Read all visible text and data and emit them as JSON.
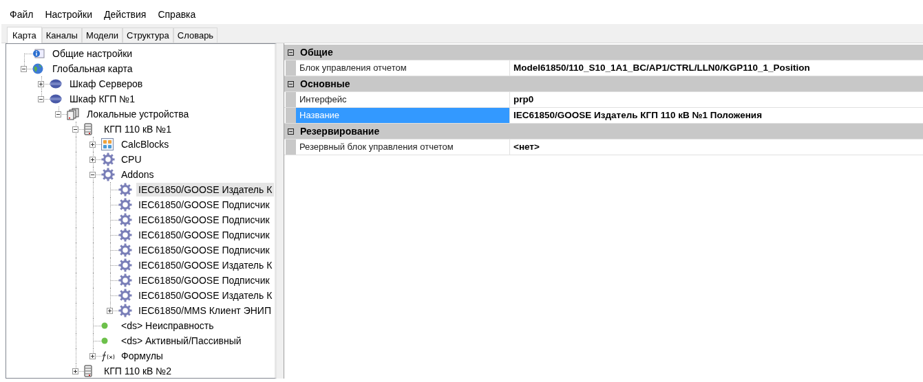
{
  "menu": [
    "Файл",
    "Настройки",
    "Действия",
    "Справка"
  ],
  "tabs": [
    {
      "label": "Карта",
      "selected": true
    },
    {
      "label": "Каналы",
      "selected": false
    },
    {
      "label": "Модели",
      "selected": false
    },
    {
      "label": "Структура",
      "selected": false
    },
    {
      "label": "Словарь",
      "selected": false
    }
  ],
  "tree": [
    {
      "label": "Общие настройки",
      "kind": "info",
      "selected": false
    },
    {
      "label": "Глобальная карта",
      "kind": "globe",
      "expanded": true,
      "selected": false,
      "children": [
        {
          "label": "Шкаф Серверов",
          "kind": "cabinet",
          "expanded": false,
          "selected": false
        },
        {
          "label": "Шкаф КГП №1",
          "kind": "cabinet",
          "expanded": true,
          "selected": false,
          "children": [
            {
              "label": "Локальные устройства",
              "kind": "devices",
              "expanded": true,
              "selected": false,
              "children": [
                {
                  "label": "КГП 110 кВ №1",
                  "kind": "server",
                  "expanded": true,
                  "selected": false,
                  "children": [
                    {
                      "label": "CalcBlocks",
                      "kind": "calc",
                      "expanded": false,
                      "selected": false
                    },
                    {
                      "label": "CPU",
                      "kind": "gear",
                      "expanded": false,
                      "selected": false
                    },
                    {
                      "label": "Addons",
                      "kind": "gear",
                      "expanded": true,
                      "selected": false,
                      "children": [
                        {
                          "label": "IEC61850/GOOSE Издатель К",
                          "kind": "gear",
                          "selected": true
                        },
                        {
                          "label": "IEC61850/GOOSE Подписчик",
                          "kind": "gear",
                          "selected": false
                        },
                        {
                          "label": "IEC61850/GOOSE Подписчик",
                          "kind": "gear",
                          "selected": false
                        },
                        {
                          "label": "IEC61850/GOOSE Подписчик",
                          "kind": "gear",
                          "selected": false
                        },
                        {
                          "label": "IEC61850/GOOSE Подписчик",
                          "kind": "gear",
                          "selected": false
                        },
                        {
                          "label": "IEC61850/GOOSE Издатель К",
                          "kind": "gear",
                          "selected": false
                        },
                        {
                          "label": "IEC61850/GOOSE Подписчик",
                          "kind": "gear",
                          "selected": false
                        },
                        {
                          "label": "IEC61850/GOOSE Издатель К",
                          "kind": "gear",
                          "selected": false
                        },
                        {
                          "label": "IEC61850/MMS Клиент ЭНИП",
                          "kind": "gear",
                          "expanded": false,
                          "selected": false
                        }
                      ]
                    },
                    {
                      "label": "<ds> Неисправность",
                      "kind": "dot",
                      "selected": false
                    },
                    {
                      "label": "<ds> Активный/Пассивный",
                      "kind": "dot",
                      "selected": false
                    },
                    {
                      "label": "Формулы",
                      "kind": "formula",
                      "expanded": false,
                      "selected": false
                    }
                  ]
                },
                {
                  "label": "КГП 110 кВ №2",
                  "kind": "server",
                  "expanded": false,
                  "selected": false
                }
              ]
            }
          ]
        }
      ]
    }
  ],
  "properties": [
    {
      "category": "Общие",
      "expanded": true,
      "rows": [
        {
          "name": "Блок управления отчетом",
          "value": "Model61850/110_S10_1A1_BC/AP1/CTRL/LLN0/KGP110_1_Position",
          "selected": false
        }
      ]
    },
    {
      "category": "Основные",
      "expanded": true,
      "rows": [
        {
          "name": "Интерфейс",
          "value": "prp0",
          "selected": false
        },
        {
          "name": "Название",
          "value": "IEC61850/GOOSE Издатель КГП 110 кВ №1 Положения",
          "selected": true
        }
      ]
    },
    {
      "category": "Резервирование",
      "expanded": true,
      "rows": [
        {
          "name": "Резервный блок управления отчетом",
          "value": "<нет>",
          "selected": false
        }
      ]
    }
  ]
}
